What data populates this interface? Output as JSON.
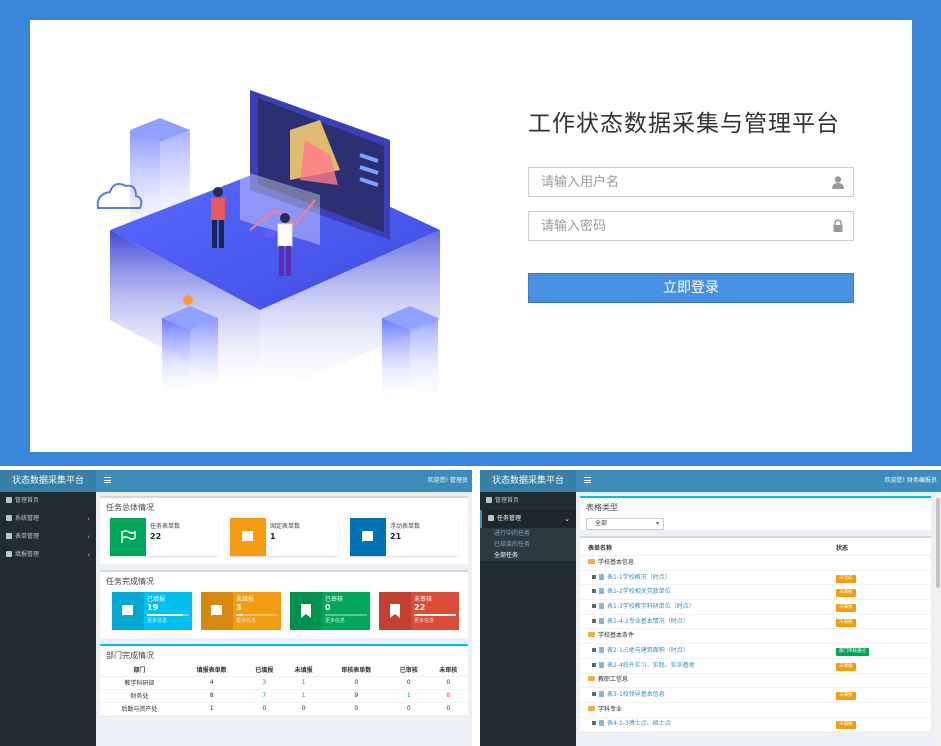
{
  "login": {
    "title": "工作状态数据采集与管理平台",
    "username_placeholder": "请输入用户名",
    "password_placeholder": "请输入密码",
    "submit_label": "立即登录"
  },
  "admin": {
    "brand": "状态数据采集平台",
    "welcome": "欢迎您! 管理员",
    "sidebar": [
      {
        "label": "管理首页",
        "icon": "dashboard-icon"
      },
      {
        "label": "系统管理",
        "icon": "gears-icon",
        "arrow": "‹"
      },
      {
        "label": "表单管理",
        "icon": "table-icon",
        "arrow": "‹"
      },
      {
        "label": "填报管理",
        "icon": "gear-icon",
        "arrow": "‹"
      }
    ],
    "overview_title": "任务总体情况",
    "overview": [
      {
        "label": "任务表单数",
        "value": "22",
        "color": "#00a65a",
        "icon": "flag-icon"
      },
      {
        "label": "固定表单数",
        "value": "1",
        "color": "#f39c12",
        "icon": "book-icon"
      },
      {
        "label": "浮动表单数",
        "value": "21",
        "color": "#0073b7",
        "icon": "book-icon"
      }
    ],
    "completion_title": "任务完成情况",
    "completion": [
      {
        "label": "已填报",
        "value": "19",
        "more": "更多信息",
        "color": "#00c0ef",
        "progress": 0.86,
        "icon": "book-icon"
      },
      {
        "label": "未填报",
        "value": "3",
        "more": "更多信息",
        "color": "#f39c12",
        "progress": 0.14,
        "icon": "book-icon"
      },
      {
        "label": "已审核",
        "value": "0",
        "more": "更多信息",
        "color": "#00a65a",
        "progress": 0,
        "icon": "bookmark-icon"
      },
      {
        "label": "未审核",
        "value": "22",
        "more": "更多信息",
        "color": "#dd4b39",
        "progress": 1,
        "icon": "bookmark-icon"
      }
    ],
    "dept_title": "部门完成情况",
    "dept_headers": [
      "部门",
      "填报表单数",
      "已填报",
      "未填报",
      "审核表单数",
      "已审核",
      "未审核"
    ],
    "dept_rows": [
      [
        "教学科研部",
        "4",
        "3",
        "1",
        "0",
        "0",
        "0"
      ],
      [
        "财务处",
        "8",
        "7",
        "1",
        "9",
        "1",
        "8"
      ],
      [
        "后勤与资产处",
        "1",
        "0",
        "0",
        "0",
        "0",
        "0"
      ]
    ]
  },
  "admin2": {
    "brand": "状态数据采集平台",
    "welcome": "欢迎您! 财务编报员",
    "sidebar_home": "管理首页",
    "sidebar_task": "任务管理",
    "sub_items": [
      "进行中的任务",
      "已结束的任务",
      "全部任务"
    ],
    "type_title": "表格类型",
    "select_value": "全部",
    "col_name": "表单名称",
    "col_status": "状态",
    "rows": [
      {
        "kind": "cat",
        "name": "学校基本信息"
      },
      {
        "kind": "item",
        "name": "表1-1学校概况（时点）",
        "status": "未完成",
        "badge": "orange"
      },
      {
        "kind": "item",
        "name": "表1-2学校相关党政单位",
        "status": "未填报",
        "badge": "orange"
      },
      {
        "kind": "item",
        "name": "表1-3学校教学科研单位（时点）",
        "status": "未填报",
        "badge": "orange"
      },
      {
        "kind": "item",
        "name": "表1-4-1专业基本情况（时点）",
        "status": "未填报",
        "badge": "orange"
      },
      {
        "kind": "cat",
        "name": "学校基本条件"
      },
      {
        "kind": "item",
        "name": "表2-1占地与建筑面积（时点）",
        "status": "部门审核通过",
        "badge": "green"
      },
      {
        "kind": "item",
        "name": "表2-4校外实习、实践、实训基地",
        "status": "未填报",
        "badge": "orange"
      },
      {
        "kind": "cat",
        "name": "教职工信息"
      },
      {
        "kind": "item",
        "name": "表3-1校领导基本信息",
        "status": "未填报",
        "badge": "orange"
      },
      {
        "kind": "cat",
        "name": "学科专业"
      },
      {
        "kind": "item",
        "name": "表4-1-3博士点、硕士点",
        "status": "未填报",
        "badge": "orange"
      }
    ]
  }
}
